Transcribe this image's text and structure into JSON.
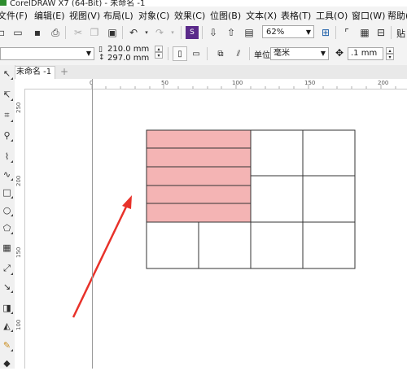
{
  "window": {
    "title": "CorelDRAW X7 (64-Bit) - 未命名 -1"
  },
  "menu": {
    "items": [
      "文件(F)",
      "编辑(E)",
      "视图(V)",
      "布局(L)",
      "对象(C)",
      "效果(C)",
      "位图(B)",
      "文本(X)",
      "表格(T)",
      "工具(O)",
      "窗口(W)",
      "帮助(H)"
    ]
  },
  "toolbar": {
    "zoom": "62%",
    "paste_label": "贴"
  },
  "propbar": {
    "width": "210.0 mm",
    "height": "297.0 mm",
    "units_label": "单位:",
    "units_value": "毫米",
    "nudge": ".1 mm"
  },
  "tabs": {
    "document": "未命名 -1"
  },
  "rulers": {
    "horizontal": [
      "0",
      "50",
      "100",
      "150",
      "200"
    ],
    "vertical": [
      "250",
      "200",
      "150",
      "100"
    ]
  },
  "table": {
    "highlight_color": "#f4b4b4",
    "line_color": "#333333",
    "arrow_color": "#e8322a"
  }
}
